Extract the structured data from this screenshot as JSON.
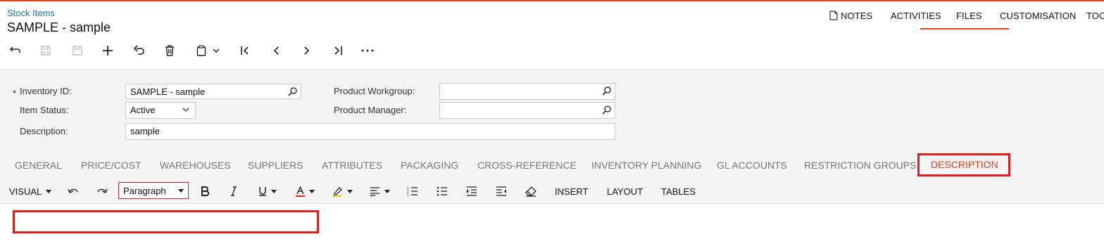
{
  "breadcrumb": "Stock Items",
  "page_title": "SAMPLE - sample",
  "top_links": {
    "notes": "NOTES",
    "activities": "ACTIVITIES",
    "files": "FILES",
    "customisation": "CUSTOMISATION",
    "tools": "TOOLS"
  },
  "form": {
    "required_mark": "*",
    "inventory_id_label": "Inventory ID:",
    "inventory_id_value": "SAMPLE - sample",
    "item_status_label": "Item Status:",
    "item_status_value": "Active",
    "description_label": "Description:",
    "description_value": "sample",
    "product_workgroup_label": "Product Workgroup:",
    "product_workgroup_value": "",
    "product_manager_label": "Product Manager:",
    "product_manager_value": ""
  },
  "tabs": [
    "GENERAL",
    "PRICE/COST",
    "WAREHOUSES",
    "SUPPLIERS",
    "ATTRIBUTES",
    "PACKAGING",
    "CROSS-REFERENCE",
    "INVENTORY PLANNING",
    "GL ACCOUNTS",
    "RESTRICTION GROUPS",
    "DESCRIPTION"
  ],
  "active_tab": "DESCRIPTION",
  "editor_toolbar": {
    "mode": "VISUAL",
    "paragraph_style": "Paragraph",
    "insert": "INSERT",
    "layout": "LAYOUT",
    "tables": "TABLES"
  },
  "colors": {
    "accent": "#e8401e",
    "highlight_box": "#e0201e",
    "link": "#1a77b8",
    "panel_bg": "#f4f4f4"
  }
}
